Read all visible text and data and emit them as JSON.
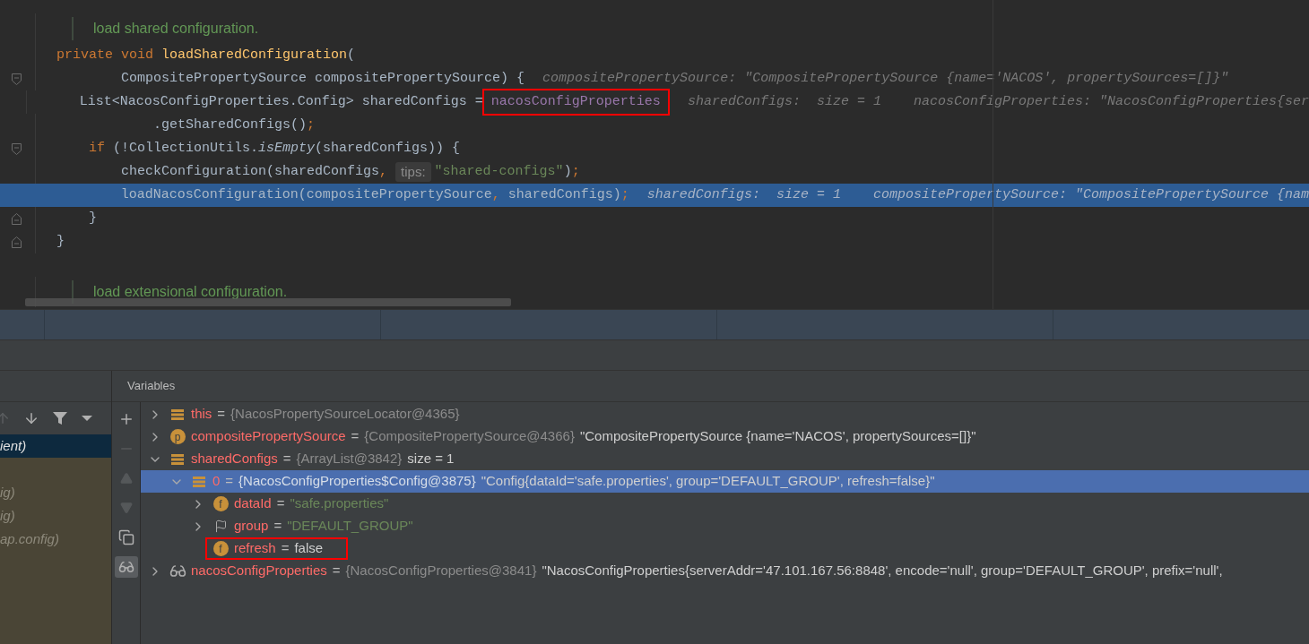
{
  "editor": {
    "lines": [
      {
        "kind": "doc",
        "text": "load shared configuration."
      },
      {
        "kind": "code",
        "tokens": [
          {
            "text": "private void ",
            "kind": "keyword"
          },
          {
            "text": "loadSharedConfiguration",
            "kind": "method"
          },
          {
            "text": "(",
            "kind": "plain"
          }
        ]
      },
      {
        "kind": "code",
        "gutter": {
          "kind": "fold_start"
        },
        "tokens": [
          {
            "text": "        CompositePropertySource compositePropertySource) {",
            "kind": "plain"
          },
          {
            "text": "compositePropertySource: \"CompositePropertySource {name='NACOS', propertySources=[]}\"",
            "kind": "hint"
          }
        ]
      },
      {
        "kind": "code",
        "tokens": [
          {
            "text": "    List<NacosConfigProperties.Config> sharedConfigs = ",
            "kind": "plain"
          },
          {
            "text": "nacosConfigProperties",
            "kind": "field",
            "annotated": true
          },
          {
            "text": "sharedConfigs:  size = 1",
            "kind": "hint"
          },
          {
            "text": "nacosConfigProperties: \"NacosConfigProperties{ser",
            "kind": "hint"
          }
        ]
      },
      {
        "kind": "code",
        "tokens": [
          {
            "text": "            .getSharedConfigs()",
            "kind": "plain"
          },
          {
            "text": ";",
            "kind": "punct"
          }
        ]
      },
      {
        "kind": "code",
        "gutter": {
          "kind": "fold_start"
        },
        "tokens": [
          {
            "text": "    if ",
            "kind": "keyword"
          },
          {
            "text": "(!CollectionUtils.",
            "kind": "plain"
          },
          {
            "text": "isEmpty",
            "kind": "static"
          },
          {
            "text": "(sharedConfigs)) {",
            "kind": "plain"
          }
        ]
      },
      {
        "kind": "code",
        "tokens": [
          {
            "text": "        checkConfiguration(sharedConfigs",
            "kind": "plain"
          },
          {
            "text": ", ",
            "kind": "punct"
          },
          {
            "text": "tips:",
            "kind": "param_hint"
          },
          {
            "text": "\"shared-configs\"",
            "kind": "string"
          },
          {
            "text": ")",
            "kind": "plain"
          },
          {
            "text": ";",
            "kind": "punct"
          }
        ]
      },
      {
        "kind": "code",
        "current": true,
        "tokens": [
          {
            "text": "        loadNacosConfiguration(compositePropertySource",
            "kind": "plain"
          },
          {
            "text": ", ",
            "kind": "punct"
          },
          {
            "text": "sharedConfigs)",
            "kind": "plain"
          },
          {
            "text": ";",
            "kind": "punct"
          },
          {
            "text": "sharedConfigs:  size = 1",
            "kind": "hint"
          },
          {
            "text": "compositePropertySource: \"CompositePropertySource {nam",
            "kind": "hint"
          }
        ]
      },
      {
        "kind": "code",
        "gutter": {
          "kind": "fold_end"
        },
        "tokens": [
          {
            "text": "    }",
            "kind": "plain"
          }
        ]
      },
      {
        "kind": "code",
        "gutter": {
          "kind": "fold_end"
        },
        "tokens": [
          {
            "text": "}",
            "kind": "plain"
          }
        ]
      },
      {
        "kind": "blank"
      },
      {
        "kind": "doc",
        "text": "load extensional configuration."
      }
    ]
  },
  "frames": {
    "toolbar": [
      {
        "kind": "up",
        "disabled": true
      },
      {
        "kind": "down",
        "disabled": false
      },
      {
        "kind": "filter",
        "disabled": false
      },
      {
        "kind": "caret",
        "disabled": false
      }
    ],
    "items": [
      {
        "text": "ient)",
        "selected": true,
        "library": false
      },
      {
        "text": "ig)",
        "selected": false,
        "library": true
      },
      {
        "text": "ig)",
        "selected": false,
        "library": true
      },
      {
        "text": "ap.config)",
        "selected": false,
        "library": true
      }
    ]
  },
  "variables": {
    "title": "Variables",
    "toolbar": [
      {
        "kind": "add",
        "disabled": false,
        "on": false
      },
      {
        "kind": "remove",
        "disabled": true,
        "on": false
      },
      {
        "kind": "up",
        "disabled": true,
        "on": false
      },
      {
        "kind": "down",
        "disabled": true,
        "on": false
      },
      {
        "kind": "copy",
        "disabled": false,
        "on": false
      },
      {
        "kind": "watch",
        "disabled": false,
        "on": true
      }
    ],
    "tree": [
      {
        "name": "this",
        "sep": "=",
        "type": "{NacosPropertySourceLocator@4365}",
        "icon": {
          "kind": "array"
        },
        "expanded": false,
        "selected": false
      },
      {
        "name": "compositePropertySource",
        "sep": "=",
        "type": "{CompositePropertySource@4366}",
        "value": {
          "text": "\"CompositePropertySource {name='NACOS', propertySources=[]}\"",
          "kind": "plain"
        },
        "icon": {
          "kind": "badge",
          "text": "p"
        },
        "expanded": false,
        "selected": false
      },
      {
        "name": "sharedConfigs",
        "sep": "=",
        "type": "{ArrayList@3842}",
        "value": {
          "text": "size = 1",
          "kind": "plain"
        },
        "icon": {
          "kind": "array"
        },
        "expanded": true,
        "selected": false,
        "children": [
          {
            "name": "0",
            "sep": "=",
            "type": "{NacosConfigProperties$Config@3875}",
            "value": {
              "text": "\"Config{dataId='safe.properties', group='DEFAULT_GROUP', refresh=false}\"",
              "kind": "plain"
            },
            "icon": {
              "kind": "array"
            },
            "expanded": true,
            "selected": true,
            "children": [
              {
                "name": "dataId",
                "sep": "=",
                "value": {
                  "text": "\"safe.properties\"",
                  "kind": "string"
                },
                "icon": {
                  "kind": "badge",
                  "text": "f"
                },
                "expanded": false,
                "selected": false
              },
              {
                "name": "group",
                "sep": "=",
                "value": {
                  "text": "\"DEFAULT_GROUP\"",
                  "kind": "string"
                },
                "icon": {
                  "kind": "flag"
                },
                "expanded": false,
                "selected": false
              },
              {
                "name": "refresh",
                "sep": "=",
                "value": {
                  "text": "false",
                  "kind": "plain"
                },
                "icon": {
                  "kind": "badge",
                  "text": "f"
                },
                "selected": false,
                "annotated": true
              }
            ]
          }
        ]
      },
      {
        "name": "nacosConfigProperties",
        "sep": "=",
        "type": "{NacosConfigProperties@3841}",
        "value": {
          "text": "\"NacosConfigProperties{serverAddr='47.101.167.56:8848', encode='null', group='DEFAULT_GROUP', prefix='null',",
          "kind": "plain"
        },
        "icon": {
          "kind": "watch"
        },
        "expanded": false,
        "selected": false
      }
    ]
  }
}
